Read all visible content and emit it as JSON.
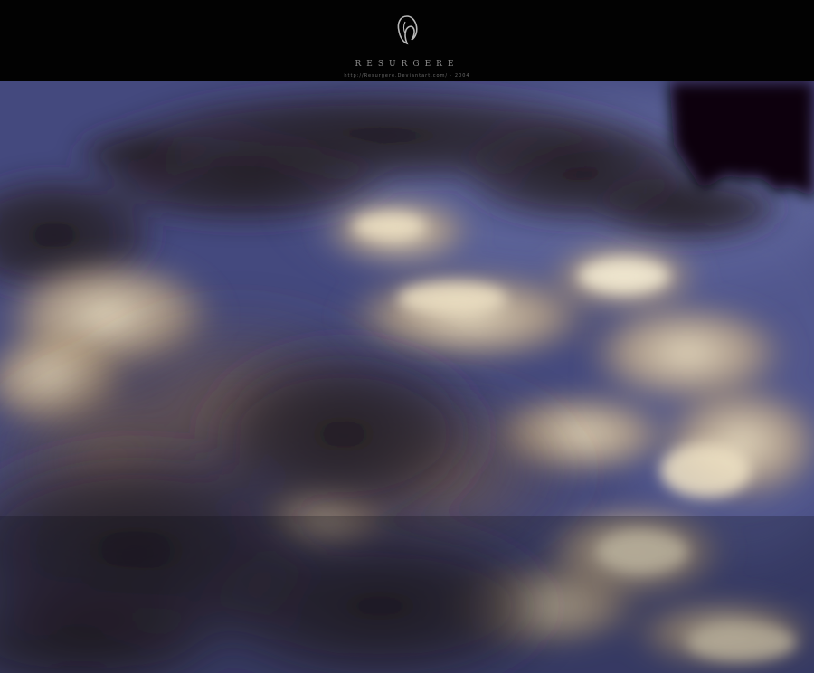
{
  "header": {
    "title": "RESURGERE",
    "url_line": "http://Resurgere.Deviantart.com/ · 2004",
    "logo_icon": "stylized-figure-logo-icon"
  },
  "photo": {
    "subject": "",
    "colors": {
      "sky_blue": "#4a5088",
      "cloud_light": "#e6dcc0",
      "cloud_dark": "#2a2228",
      "tree_silhouette": "#080608"
    }
  }
}
